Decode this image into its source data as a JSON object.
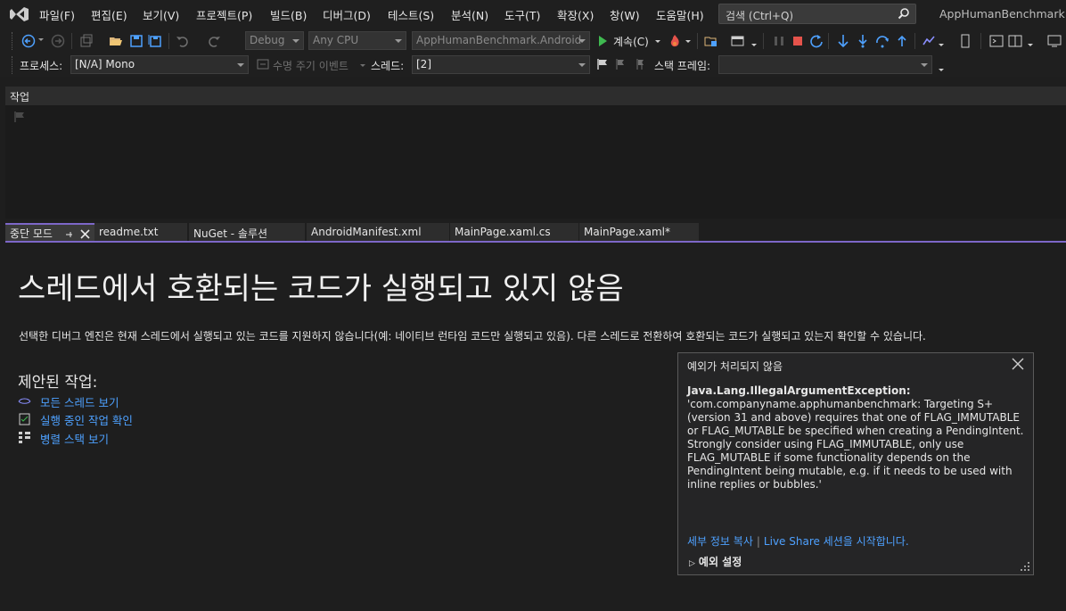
{
  "menubar": {
    "items": [
      "파일(F)",
      "편집(E)",
      "보기(V)",
      "프로젝트(P)",
      "빌드(B)",
      "디버그(D)",
      "테스트(S)",
      "분석(N)",
      "도구(T)",
      "확장(X)",
      "창(W)",
      "도움말(H)"
    ],
    "search_placeholder": "검색 (Ctrl+Q)",
    "app_title": "AppHumanBenchmark"
  },
  "toolbar": {
    "config": "Debug",
    "platform": "Any CPU",
    "startup_project": "AppHumanBenchmark.Android",
    "continue_label": "계속(C)"
  },
  "debug_location": {
    "process_label": "프로세스:",
    "process_value": "[N/A] Mono",
    "lifecycle_label": "수명 주기 이벤트",
    "thread_label": "스레드:",
    "thread_value": "[2]",
    "stackframe_label": "스택 프레임:",
    "stackframe_value": ""
  },
  "task_panel": {
    "title": "작업"
  },
  "tabs": [
    {
      "label": "중단 모드"
    },
    {
      "label": "readme.txt"
    },
    {
      "label": "NuGet - 솔루션"
    },
    {
      "label": "AndroidManifest.xml"
    },
    {
      "label": "MainPage.xaml.cs"
    },
    {
      "label": "MainPage.xaml*"
    }
  ],
  "break_mode": {
    "title": "스레드에서 호환되는 코드가 실행되고 있지 않음",
    "description": "선택한 디버그 엔진은 현재 스레드에서 실행되고 있는 코드를 지원하지 않습니다(예: 네이티브 런타임 코드만 실행되고 있음). 다른 스레드로 전환하여 호환되는 코드가 실행되고 있는지 확인할 수 있습니다.",
    "suggested_title": "제안된 작업:",
    "actions": [
      "모든 스레드 보기",
      "실행 중인 작업 확인",
      "병렬 스택 보기"
    ]
  },
  "exception_popup": {
    "title": "예외가 처리되지 않음",
    "exception_name": "Java.Lang.IllegalArgumentException:",
    "message": "'com.companyname.apphumanbenchmark: Targeting S+ (version 31 and above) requires that one of FLAG_IMMUTABLE or FLAG_MUTABLE be specified when creating a PendingIntent. Strongly consider using FLAG_IMMUTABLE, only use FLAG_MUTABLE if some functionality depends on the PendingIntent being mutable, e.g. if it needs to be used with inline replies or bubbles.'",
    "copy_details": "세부 정보 복사",
    "live_share": "Live Share 세션을 시작합니다.",
    "exception_settings": "예외 설정"
  },
  "colors": {
    "accent": "#7d67c8",
    "link": "#4ea1ff",
    "background": "#1e1e1e"
  }
}
